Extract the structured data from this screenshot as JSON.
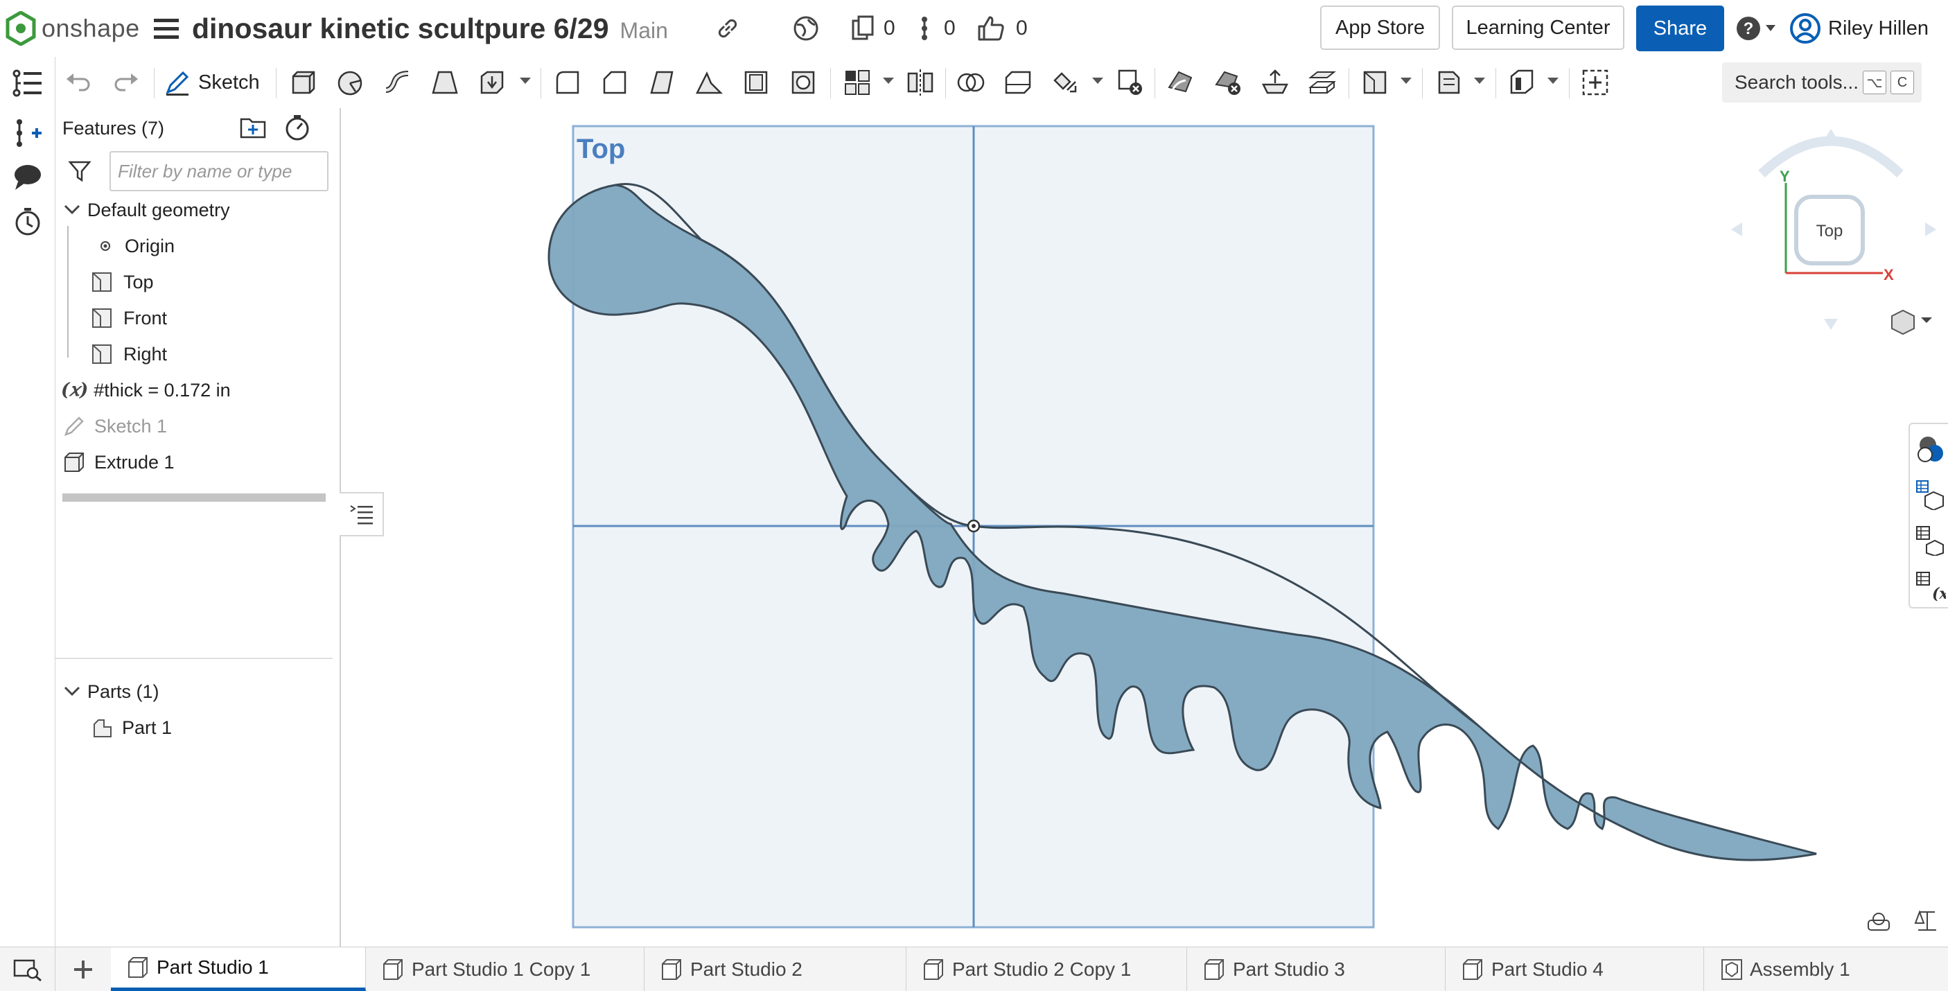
{
  "header": {
    "logo_text": "onshape",
    "document_title": "dinosaur kinetic scultpure 6/29",
    "branch": "Main",
    "versions_count": "0",
    "branches_count": "0",
    "likes_count": "0",
    "app_store_label": "App Store",
    "learning_center_label": "Learning Center",
    "share_label": "Share",
    "user_name": "Riley Hillen",
    "accent_color": "#0a5fb4"
  },
  "toolbar": {
    "sketch_label": "Sketch",
    "search_label": "Search tools...",
    "search_key1": "⌥",
    "search_key2": "C"
  },
  "features": {
    "header_label": "Features (7)",
    "filter_placeholder": "Filter by name or type",
    "default_geometry_label": "Default geometry",
    "origin_label": "Origin",
    "top_label": "Top",
    "front_label": "Front",
    "right_label": "Right",
    "variable_label": "#thick = 0.172 in",
    "sketch1_label": "Sketch 1",
    "extrude1_label": "Extrude 1"
  },
  "parts": {
    "header_label": "Parts (1)",
    "part1_label": "Part 1"
  },
  "viewport": {
    "plane_label": "Top",
    "view_cube_label": "Top",
    "axis_y": "Y",
    "axis_x": "X",
    "part_color": "#7ea6bf",
    "plane_color": "#6f9ac6"
  },
  "tabs": [
    {
      "label": "Part Studio 1"
    },
    {
      "label": "Part Studio 1 Copy 1"
    },
    {
      "label": "Part Studio 2"
    },
    {
      "label": "Part Studio 2 Copy 1"
    },
    {
      "label": "Part Studio 3"
    },
    {
      "label": "Part Studio 4"
    },
    {
      "label": "Assembly 1"
    }
  ]
}
